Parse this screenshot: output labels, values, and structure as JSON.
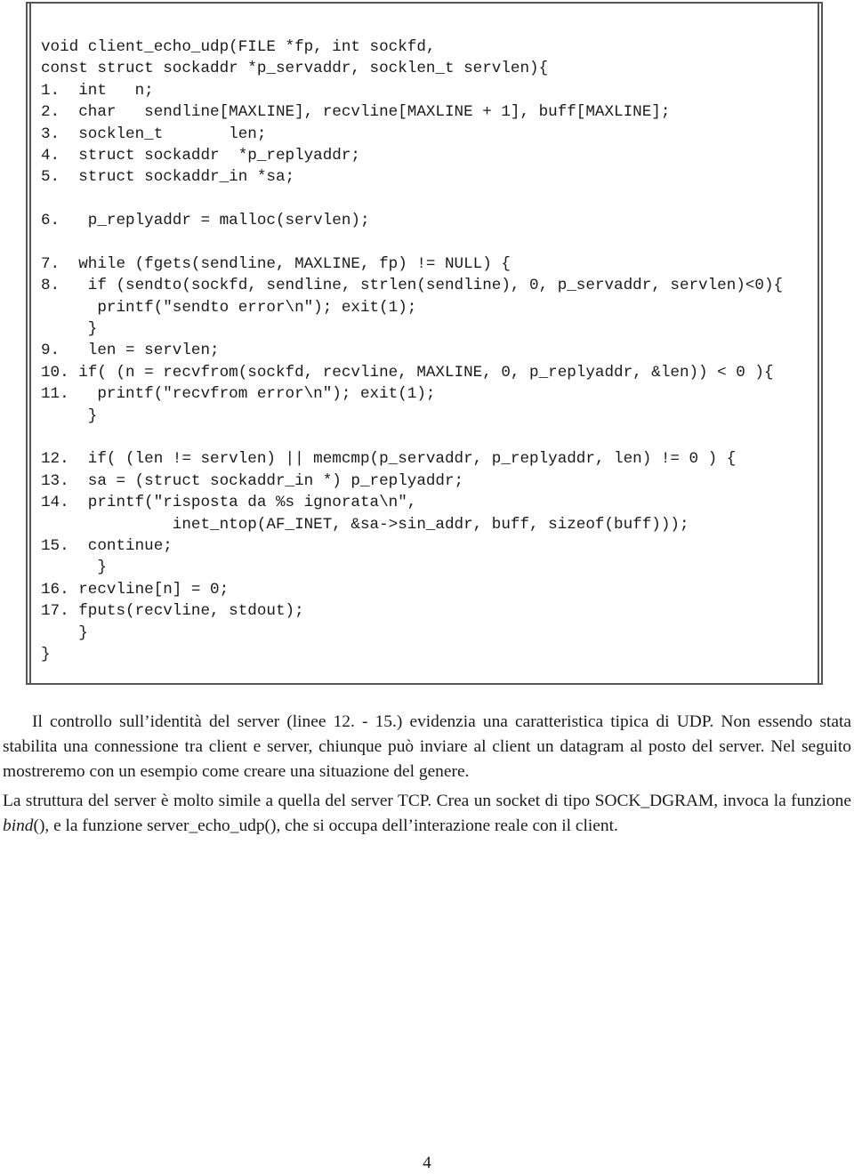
{
  "code_listing": {
    "lines": [
      "void client_echo_udp(FILE *fp, int sockfd,",
      "const struct sockaddr *p_servaddr, socklen_t servlen){",
      "1.  int   n;",
      "2.  char   sendline[MAXLINE], recvline[MAXLINE + 1], buff[MAXLINE];",
      "3.  socklen_t       len;",
      "4.  struct sockaddr  *p_replyaddr;",
      "5.  struct sockaddr_in *sa;",
      "",
      "6.   p_replyaddr = malloc(servlen);",
      "",
      "7.  while (fgets(sendline, MAXLINE, fp) != NULL) {",
      "8.   if (sendto(sockfd, sendline, strlen(sendline), 0, p_servaddr, servlen)<0){",
      "      printf(\"sendto error\\n\"); exit(1);",
      "     }",
      "9.   len = servlen;",
      "10. if( (n = recvfrom(sockfd, recvline, MAXLINE, 0, p_replyaddr, &len)) < 0 ){",
      "11.   printf(\"recvfrom error\\n\"); exit(1);",
      "     }",
      "",
      "12.  if( (len != servlen) || memcmp(p_servaddr, p_replyaddr, len) != 0 ) {",
      "13.  sa = (struct sockaddr_in *) p_replyaddr;",
      "14.  printf(\"risposta da %s ignorata\\n\",",
      "              inet_ntop(AF_INET, &sa->sin_addr, buff, sizeof(buff)));",
      "15.  continue;",
      "      }",
      "16. recvline[n] = 0;",
      "17. fputs(recvline, stdout);",
      "    }",
      "}"
    ]
  },
  "paragraphs": [
    {
      "parts": [
        {
          "text": "Il controllo sull’identità del server (linee 12. - 15.) evidenzia una caratteristica tipica di UDP. Non essendo stata stabilita una connessione tra client e server, chiunque può inviare al client un datagram al posto del server. Nel seguito mostreremo con un esempio come creare una situazione del genere.",
          "italic": false
        }
      ]
    },
    {
      "parts": [
        {
          "text": "La struttura del server è molto simile a quella del server TCP. Crea un socket di tipo SOCK_DGRAM, invoca la funzione ",
          "italic": false
        },
        {
          "text": "bind",
          "italic": true
        },
        {
          "text": "(), e la funzione server_echo_udp(), che si occupa dell’interazione reale con il client.",
          "italic": false
        }
      ]
    }
  ],
  "page_number": "4"
}
